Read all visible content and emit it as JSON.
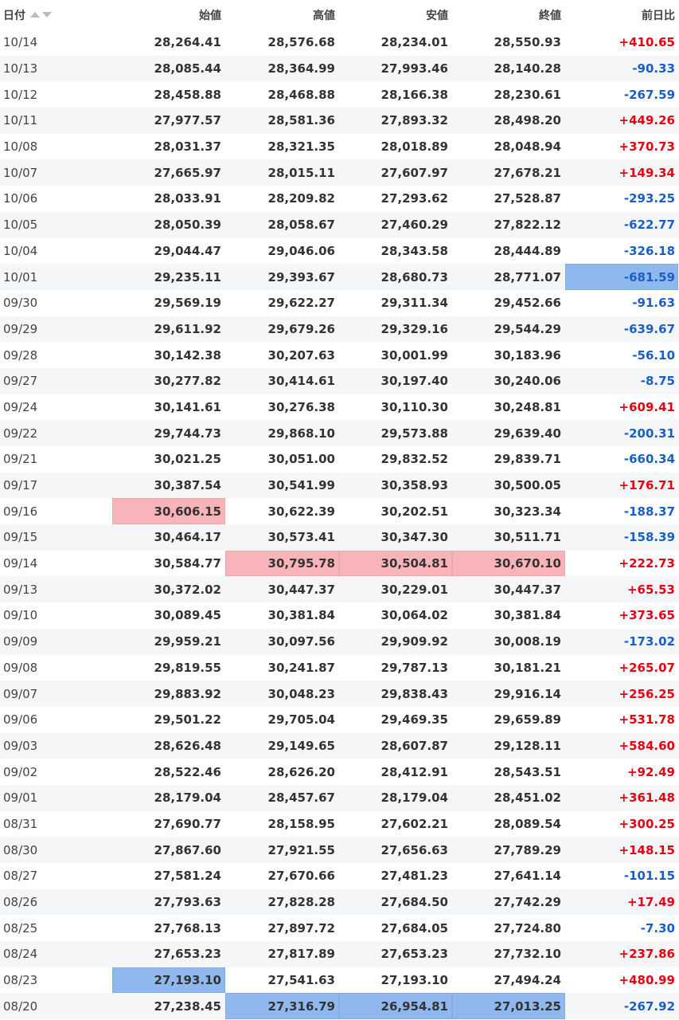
{
  "colors": {
    "up": "#e60012",
    "down": "#1a5fc8",
    "high_highlight": "#f8b4b8",
    "low_highlight": "#8fb8ee"
  },
  "table": {
    "headers": [
      "日付",
      "始値",
      "高値",
      "安値",
      "終値",
      "前日比"
    ],
    "sort_icons": [
      "sort-ascending-icon",
      "sort-descending-icon"
    ],
    "rows": [
      {
        "date": "10/14",
        "open": "28,264.41",
        "high": "28,576.68",
        "low": "28,234.01",
        "close": "28,550.93",
        "change": "+410.65"
      },
      {
        "date": "10/13",
        "open": "28,085.44",
        "high": "28,364.99",
        "low": "27,993.46",
        "close": "28,140.28",
        "change": "-90.33"
      },
      {
        "date": "10/12",
        "open": "28,458.88",
        "high": "28,468.88",
        "low": "28,166.38",
        "close": "28,230.61",
        "change": "-267.59"
      },
      {
        "date": "10/11",
        "open": "27,977.57",
        "high": "28,581.36",
        "low": "27,893.32",
        "close": "28,498.20",
        "change": "+449.26"
      },
      {
        "date": "10/08",
        "open": "28,031.37",
        "high": "28,321.35",
        "low": "28,018.89",
        "close": "28,048.94",
        "change": "+370.73"
      },
      {
        "date": "10/07",
        "open": "27,665.97",
        "high": "28,015.11",
        "low": "27,607.97",
        "close": "27,678.21",
        "change": "+149.34"
      },
      {
        "date": "10/06",
        "open": "28,033.91",
        "high": "28,209.82",
        "low": "27,293.62",
        "close": "27,528.87",
        "change": "-293.25"
      },
      {
        "date": "10/05",
        "open": "28,050.39",
        "high": "28,058.67",
        "low": "27,460.29",
        "close": "27,822.12",
        "change": "-622.77"
      },
      {
        "date": "10/04",
        "open": "29,044.47",
        "high": "29,046.06",
        "low": "28,343.58",
        "close": "28,444.89",
        "change": "-326.18"
      },
      {
        "date": "10/01",
        "open": "29,235.11",
        "high": "29,393.67",
        "low": "28,680.73",
        "close": "28,771.07",
        "change": "-681.59",
        "hl": {
          "change": "low"
        }
      },
      {
        "date": "09/30",
        "open": "29,569.19",
        "high": "29,622.27",
        "low": "29,311.34",
        "close": "29,452.66",
        "change": "-91.63"
      },
      {
        "date": "09/29",
        "open": "29,611.92",
        "high": "29,679.26",
        "low": "29,329.16",
        "close": "29,544.29",
        "change": "-639.67"
      },
      {
        "date": "09/28",
        "open": "30,142.38",
        "high": "30,207.63",
        "low": "30,001.99",
        "close": "30,183.96",
        "change": "-56.10"
      },
      {
        "date": "09/27",
        "open": "30,277.82",
        "high": "30,414.61",
        "low": "30,197.40",
        "close": "30,240.06",
        "change": "-8.75"
      },
      {
        "date": "09/24",
        "open": "30,141.61",
        "high": "30,276.38",
        "low": "30,110.30",
        "close": "30,248.81",
        "change": "+609.41"
      },
      {
        "date": "09/22",
        "open": "29,744.73",
        "high": "29,868.10",
        "low": "29,573.88",
        "close": "29,639.40",
        "change": "-200.31"
      },
      {
        "date": "09/21",
        "open": "30,021.25",
        "high": "30,051.00",
        "low": "29,832.52",
        "close": "29,839.71",
        "change": "-660.34"
      },
      {
        "date": "09/17",
        "open": "30,387.54",
        "high": "30,541.99",
        "low": "30,358.93",
        "close": "30,500.05",
        "change": "+176.71"
      },
      {
        "date": "09/16",
        "open": "30,606.15",
        "high": "30,622.39",
        "low": "30,202.51",
        "close": "30,323.34",
        "change": "-188.37",
        "hl": {
          "open": "high"
        }
      },
      {
        "date": "09/15",
        "open": "30,464.17",
        "high": "30,573.41",
        "low": "30,347.30",
        "close": "30,511.71",
        "change": "-158.39"
      },
      {
        "date": "09/14",
        "open": "30,584.77",
        "high": "30,795.78",
        "low": "30,504.81",
        "close": "30,670.10",
        "change": "+222.73",
        "hl": {
          "high": "high",
          "low": "high",
          "close": "high"
        }
      },
      {
        "date": "09/13",
        "open": "30,372.02",
        "high": "30,447.37",
        "low": "30,229.01",
        "close": "30,447.37",
        "change": "+65.53"
      },
      {
        "date": "09/10",
        "open": "30,089.45",
        "high": "30,381.84",
        "low": "30,064.02",
        "close": "30,381.84",
        "change": "+373.65"
      },
      {
        "date": "09/09",
        "open": "29,959.21",
        "high": "30,097.56",
        "low": "29,909.92",
        "close": "30,008.19",
        "change": "-173.02"
      },
      {
        "date": "09/08",
        "open": "29,819.55",
        "high": "30,241.87",
        "low": "29,787.13",
        "close": "30,181.21",
        "change": "+265.07"
      },
      {
        "date": "09/07",
        "open": "29,883.92",
        "high": "30,048.23",
        "low": "29,838.43",
        "close": "29,916.14",
        "change": "+256.25"
      },
      {
        "date": "09/06",
        "open": "29,501.22",
        "high": "29,705.04",
        "low": "29,469.35",
        "close": "29,659.89",
        "change": "+531.78"
      },
      {
        "date": "09/03",
        "open": "28,626.48",
        "high": "29,149.65",
        "low": "28,607.87",
        "close": "29,128.11",
        "change": "+584.60"
      },
      {
        "date": "09/02",
        "open": "28,522.46",
        "high": "28,626.20",
        "low": "28,412.91",
        "close": "28,543.51",
        "change": "+92.49"
      },
      {
        "date": "09/01",
        "open": "28,179.04",
        "high": "28,457.67",
        "low": "28,179.04",
        "close": "28,451.02",
        "change": "+361.48"
      },
      {
        "date": "08/31",
        "open": "27,690.77",
        "high": "28,158.95",
        "low": "27,602.21",
        "close": "28,089.54",
        "change": "+300.25"
      },
      {
        "date": "08/30",
        "open": "27,867.60",
        "high": "27,921.55",
        "low": "27,656.63",
        "close": "27,789.29",
        "change": "+148.15"
      },
      {
        "date": "08/27",
        "open": "27,581.24",
        "high": "27,670.66",
        "low": "27,481.23",
        "close": "27,641.14",
        "change": "-101.15"
      },
      {
        "date": "08/26",
        "open": "27,793.63",
        "high": "27,828.28",
        "low": "27,684.50",
        "close": "27,742.29",
        "change": "+17.49"
      },
      {
        "date": "08/25",
        "open": "27,768.13",
        "high": "27,897.72",
        "low": "27,684.05",
        "close": "27,724.80",
        "change": "-7.30"
      },
      {
        "date": "08/24",
        "open": "27,653.23",
        "high": "27,817.89",
        "low": "27,653.23",
        "close": "27,732.10",
        "change": "+237.86"
      },
      {
        "date": "08/23",
        "open": "27,193.10",
        "high": "27,541.63",
        "low": "27,193.10",
        "close": "27,494.24",
        "change": "+480.99",
        "hl": {
          "open": "low"
        }
      },
      {
        "date": "08/20",
        "open": "27,238.45",
        "high": "27,316.79",
        "low": "26,954.81",
        "close": "27,013.25",
        "change": "-267.92",
        "hl": {
          "high": "low",
          "low": "low",
          "close": "low"
        }
      }
    ]
  }
}
